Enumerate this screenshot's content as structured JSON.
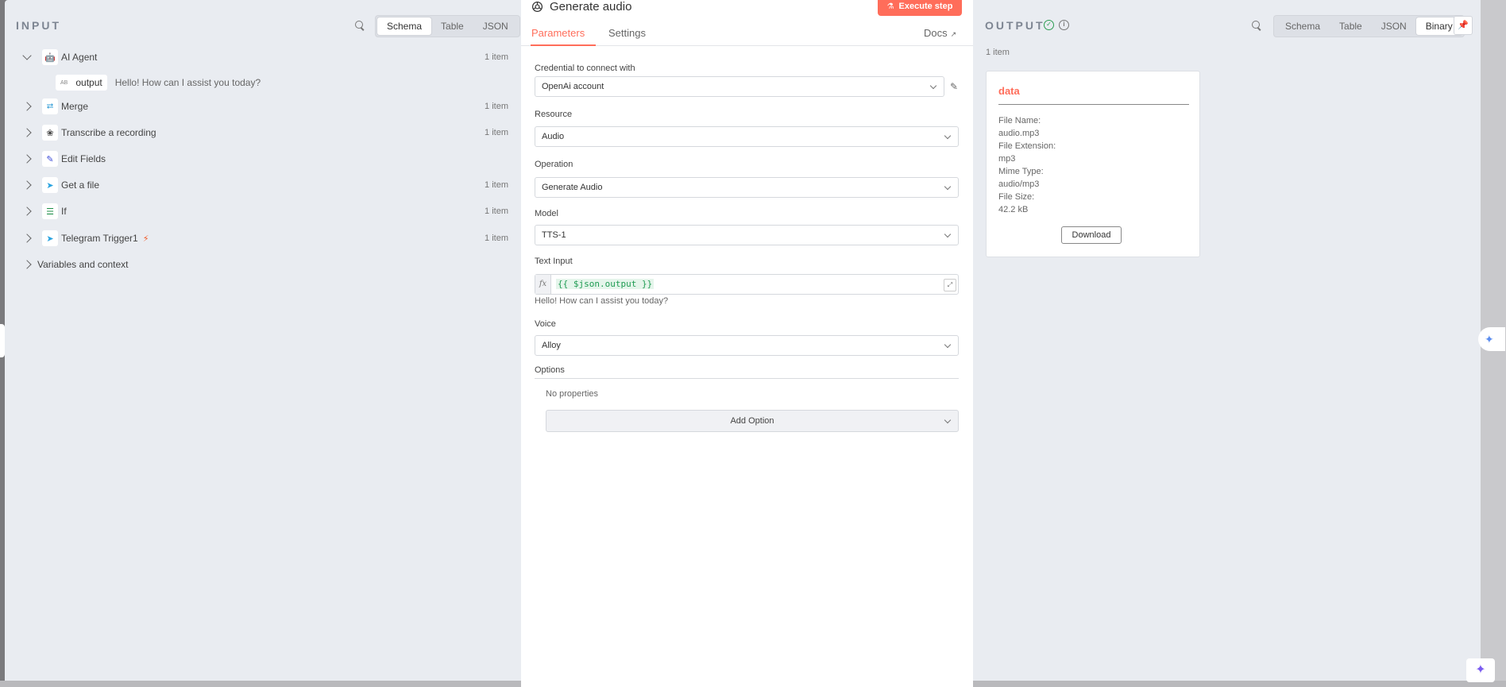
{
  "input_panel": {
    "title": "INPUT",
    "views": [
      "Schema",
      "Table",
      "JSON"
    ],
    "active_view": "Schema",
    "nodes": [
      {
        "label": "AI Agent",
        "count": "1 item",
        "expanded": true,
        "icon": "ai-agent-icon"
      },
      {
        "label": "Merge",
        "count": "1 item",
        "icon": "merge-icon"
      },
      {
        "label": "Transcribe a recording",
        "count": "1 item",
        "icon": "openai-icon"
      },
      {
        "label": "Edit Fields",
        "count": "",
        "icon": "pencil-icon"
      },
      {
        "label": "Get a file",
        "count": "1 item",
        "icon": "telegram-icon"
      },
      {
        "label": "If",
        "count": "1 item",
        "icon": "if-icon"
      },
      {
        "label": "Telegram Trigger1",
        "count": "1 item",
        "icon": "telegram-icon",
        "trigger": true
      }
    ],
    "field": {
      "type": "AB",
      "name": "output",
      "value": "Hello! How can I assist you today?"
    },
    "variables_label": "Variables and context"
  },
  "node": {
    "title": "Generate audio",
    "execute_label": "Execute step",
    "tabs": [
      "Parameters",
      "Settings"
    ],
    "active_tab": "Parameters",
    "docs_label": "Docs",
    "credential_label": "Credential to connect with",
    "credential_value": "OpenAi account",
    "resource_label": "Resource",
    "resource_value": "Audio",
    "operation_label": "Operation",
    "operation_value": "Generate Audio",
    "model_label": "Model",
    "model_value": "TTS-1",
    "text_input_label": "Text Input",
    "text_input_expression": "{{ $json.output }}",
    "text_input_preview": "Hello! How can I assist you today?",
    "voice_label": "Voice",
    "voice_value": "Alloy",
    "options_label": "Options",
    "no_properties": "No properties",
    "add_option_label": "Add Option"
  },
  "output_panel": {
    "title": "OUTPUT",
    "views": [
      "Schema",
      "Table",
      "JSON",
      "Binary"
    ],
    "active_view": "Binary",
    "items_count": "1 item",
    "card": {
      "title": "data",
      "file_name_label": "File Name:",
      "file_name": "audio.mp3",
      "file_extension_label": "File Extension:",
      "file_extension": "mp3",
      "mime_type_label": "Mime Type:",
      "mime_type": "audio/mp3",
      "file_size_label": "File Size:",
      "file_size": "42.2 kB",
      "download_label": "Download"
    }
  },
  "colors": {
    "accent": "#ff6d5a",
    "success": "#2c9c51",
    "panel_bg": "#e9ecf1"
  }
}
